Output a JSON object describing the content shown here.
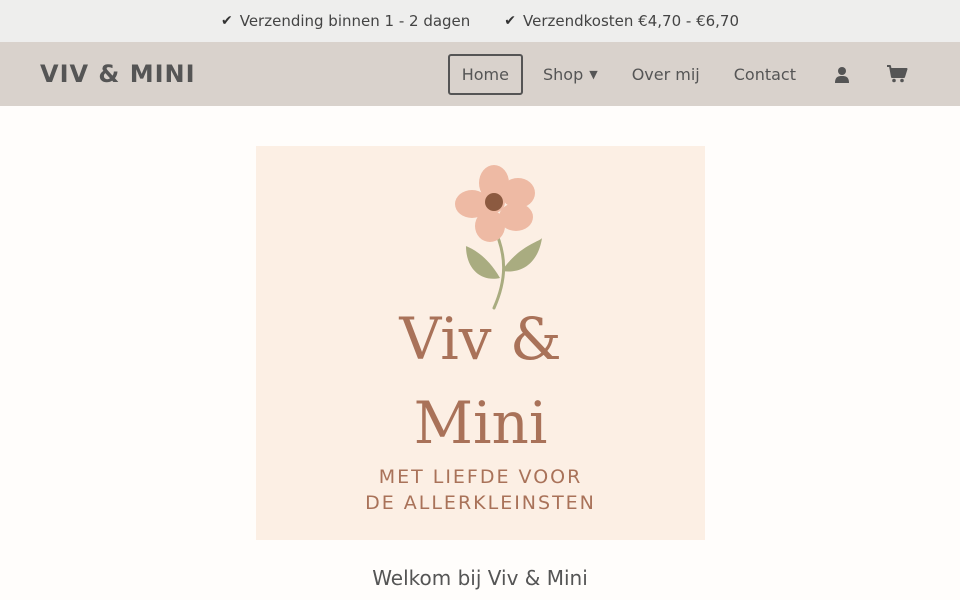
{
  "topbar": {
    "items": [
      {
        "icon": "check-icon",
        "text": "Verzending binnen 1 - 2 dagen"
      },
      {
        "icon": "check-icon",
        "text": "Verzendkosten €4,70 - €6,70"
      }
    ]
  },
  "header": {
    "brand": "VIV & MINI",
    "nav": [
      {
        "label": "Home",
        "active": true
      },
      {
        "label": "Shop",
        "has_dropdown": true
      },
      {
        "label": "Over mij"
      },
      {
        "label": "Contact"
      }
    ],
    "icons": [
      "user-icon",
      "cart-icon"
    ]
  },
  "logo": {
    "title_line1": "Viv &",
    "title_line2": "Mini",
    "subtitle_line1": "MET LIEFDE VOOR",
    "subtitle_line2": "DE ALLERKLEINSTEN",
    "colors": {
      "background": "#fcefe4",
      "petal": "#eebaa4",
      "center": "#8c5a40",
      "leaf": "#a9ac80",
      "text": "#a97259"
    }
  },
  "main": {
    "welcome": "Welkom bij Viv & Mini"
  },
  "colors": {
    "topbar_bg": "#eeeeed",
    "header_bg": "#d9d2cc",
    "page_bg": "#fffdfb"
  }
}
